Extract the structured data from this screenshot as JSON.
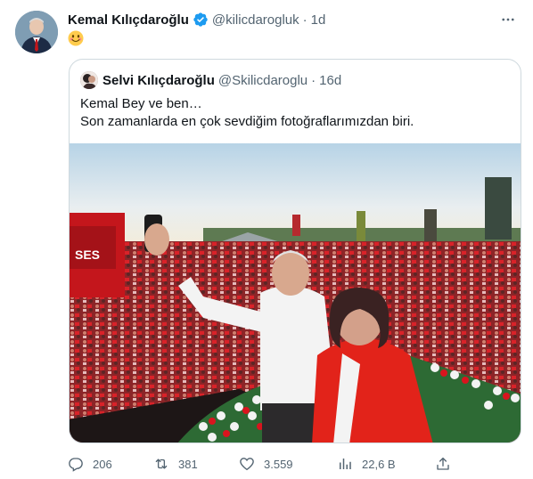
{
  "tweet": {
    "author_name": "Kemal Kılıçdaroğlu",
    "handle": "@kilicdarogluk",
    "separator": "·",
    "time": "1d",
    "emoji": "smiling-face-emoji"
  },
  "quote": {
    "author_name": "Selvi Kılıçdaroğlu",
    "handle": "@Skilicdaroglu",
    "separator": "·",
    "time": "16d",
    "lines": [
      "Kemal Bey ve ben…",
      "Son zamanlarda en çok sevdiğim fotoğraflarımızdan biri."
    ],
    "photo_banner_text": "SES"
  },
  "actions": {
    "replies": "206",
    "retweets": "381",
    "likes": "3.559",
    "views": "22,6 B"
  },
  "colors": {
    "verified": "#1d9bf0",
    "text": "#0f1419",
    "secondary": "#536471",
    "border": "#cfd9de",
    "flag_red": "#d9141e"
  }
}
